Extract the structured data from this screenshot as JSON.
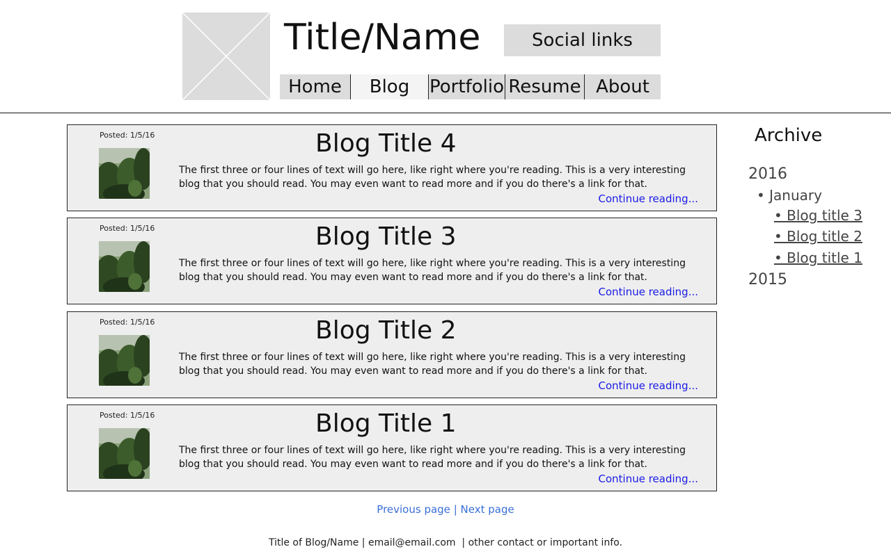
{
  "header": {
    "site_title": "Title/Name",
    "social_label": "Social links",
    "nav": [
      {
        "label": "Home"
      },
      {
        "label": "Blog"
      },
      {
        "label": "Portfolio"
      },
      {
        "label": "Resume"
      },
      {
        "label": "About"
      }
    ],
    "active_nav": "Blog"
  },
  "posts": [
    {
      "date": "Posted: 1/5/16",
      "title": "Blog Title 4",
      "excerpt": "The first three or four lines of text will go here, like right where you're reading. This is a very interesting blog that you should read. You may even want to read more and if you do there's a link for that.",
      "more": "Continue reading..."
    },
    {
      "date": "Posted: 1/5/16",
      "title": "Blog Title 3",
      "excerpt": "The first three or four lines of text will go here, like right where you're reading. This is a very interesting blog that you should read. You may even want to read more and if you do there's a link for that.",
      "more": "Continue reading..."
    },
    {
      "date": "Posted: 1/5/16",
      "title": "Blog Title 2",
      "excerpt": "The first three or four lines of text will go here, like right where you're reading. This is a very interesting blog that you should read. You may even want to read more and if you do there's a link for that.",
      "more": "Continue reading..."
    },
    {
      "date": "Posted: 1/5/16",
      "title": "Blog Title 1",
      "excerpt": "The first three or four lines of text will go here, like right where you're reading. This is a very interesting blog that you should read. You may even want to read more and if you do there's a link for that.",
      "more": "Continue reading..."
    }
  ],
  "pager": {
    "previous": "Previous page",
    "separator": "|",
    "next": "Next page"
  },
  "footer": {
    "text": "Title of Blog/Name | email@email.com  | other contact or important info."
  },
  "archive": {
    "title": "Archive",
    "year_2016": "2016",
    "month_january": "• January",
    "posts": [
      "• Blog title 3",
      "• Blog title 2",
      "• Blog title 1"
    ],
    "year_2015": "2015"
  },
  "colors": {
    "link": "#1a1ae6",
    "pager_link": "#3a6fd8",
    "placeholder": "#dcdcdc",
    "post_bg": "#eeeeee"
  }
}
